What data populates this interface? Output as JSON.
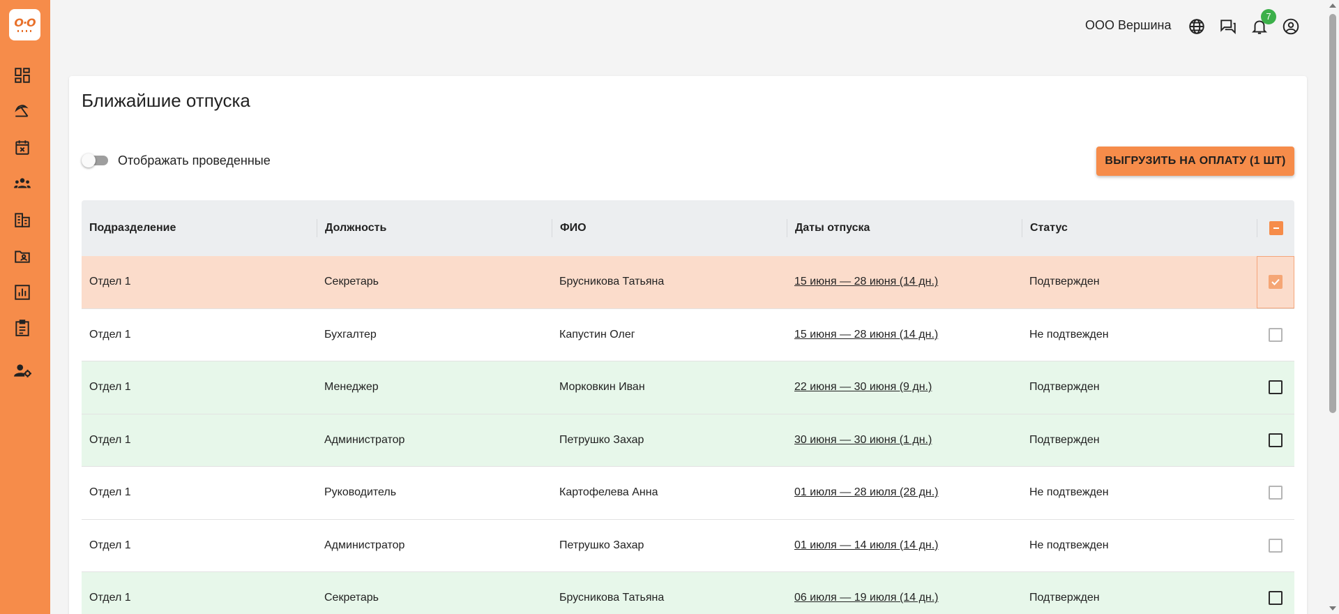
{
  "brand": {
    "logo_text": "O·O",
    "accent_color": "#f68c4a"
  },
  "sidebar": {
    "items": [
      {
        "name": "dashboard-icon"
      },
      {
        "name": "vacation-beach-icon"
      },
      {
        "name": "calendar-cancel-icon"
      },
      {
        "name": "team-icon"
      },
      {
        "name": "company-building-icon"
      },
      {
        "name": "employee-folder-icon"
      },
      {
        "name": "reports-chart-icon"
      },
      {
        "name": "documents-clipboard-icon"
      },
      {
        "name": "user-settings-icon"
      }
    ]
  },
  "topbar": {
    "company": "ООО Вершина",
    "notifications_count": "7",
    "icons": [
      "globe-icon",
      "chat-icon",
      "bell-icon",
      "account-icon"
    ]
  },
  "page": {
    "title": "Ближайшие отпуска",
    "toggle_label": "Отображать проведенные",
    "toggle_on": false,
    "export_button": "ВЫГРУЗИТЬ НА ОПЛАТУ (1 ШТ)"
  },
  "table": {
    "columns": [
      "Подразделение",
      "Должность",
      "ФИО",
      "Даты отпуска",
      "Статус"
    ],
    "header_checkbox": "indeterminate",
    "rows": [
      {
        "dept": "Отдел 1",
        "position": "Секретарь",
        "name": "Брусникова Татьяна",
        "dates": "15 июня — 28 июня (14 дн.)",
        "status": "Подтвержден",
        "state": "selected",
        "checked": true
      },
      {
        "dept": "Отдел 1",
        "position": "Бухгалтер",
        "name": "Капустин Олег",
        "dates": "15 июня — 28 июня (14 дн.)",
        "status": "Не подтвежден",
        "state": "plain",
        "checked": false
      },
      {
        "dept": "Отдел 1",
        "position": "Менеджер",
        "name": "Морковкин Иван",
        "dates": "22 июня — 30 июня (9 дн.)",
        "status": "Подтвержден",
        "state": "confirmed",
        "checked": false
      },
      {
        "dept": "Отдел 1",
        "position": "Администратор",
        "name": "Петрушко Захар",
        "dates": "30 июня — 30 июня (1 дн.)",
        "status": "Подтвержден",
        "state": "confirmed",
        "checked": false
      },
      {
        "dept": "Отдел 1",
        "position": "Руководитель",
        "name": "Картофелева Анна",
        "dates": "01 июля — 28 июля (28 дн.)",
        "status": "Не подтвежден",
        "state": "plain",
        "checked": false
      },
      {
        "dept": "Отдел 1",
        "position": "Администратор",
        "name": "Петрушко Захар",
        "dates": "01 июля — 14 июля (14 дн.)",
        "status": "Не подтвежден",
        "state": "plain",
        "checked": false
      },
      {
        "dept": "Отдел 1",
        "position": "Секретарь",
        "name": "Брусникова Татьяна",
        "dates": "06 июля — 19 июля (14 дн.)",
        "status": "Подтвержден",
        "state": "confirmed",
        "checked": false
      }
    ]
  }
}
